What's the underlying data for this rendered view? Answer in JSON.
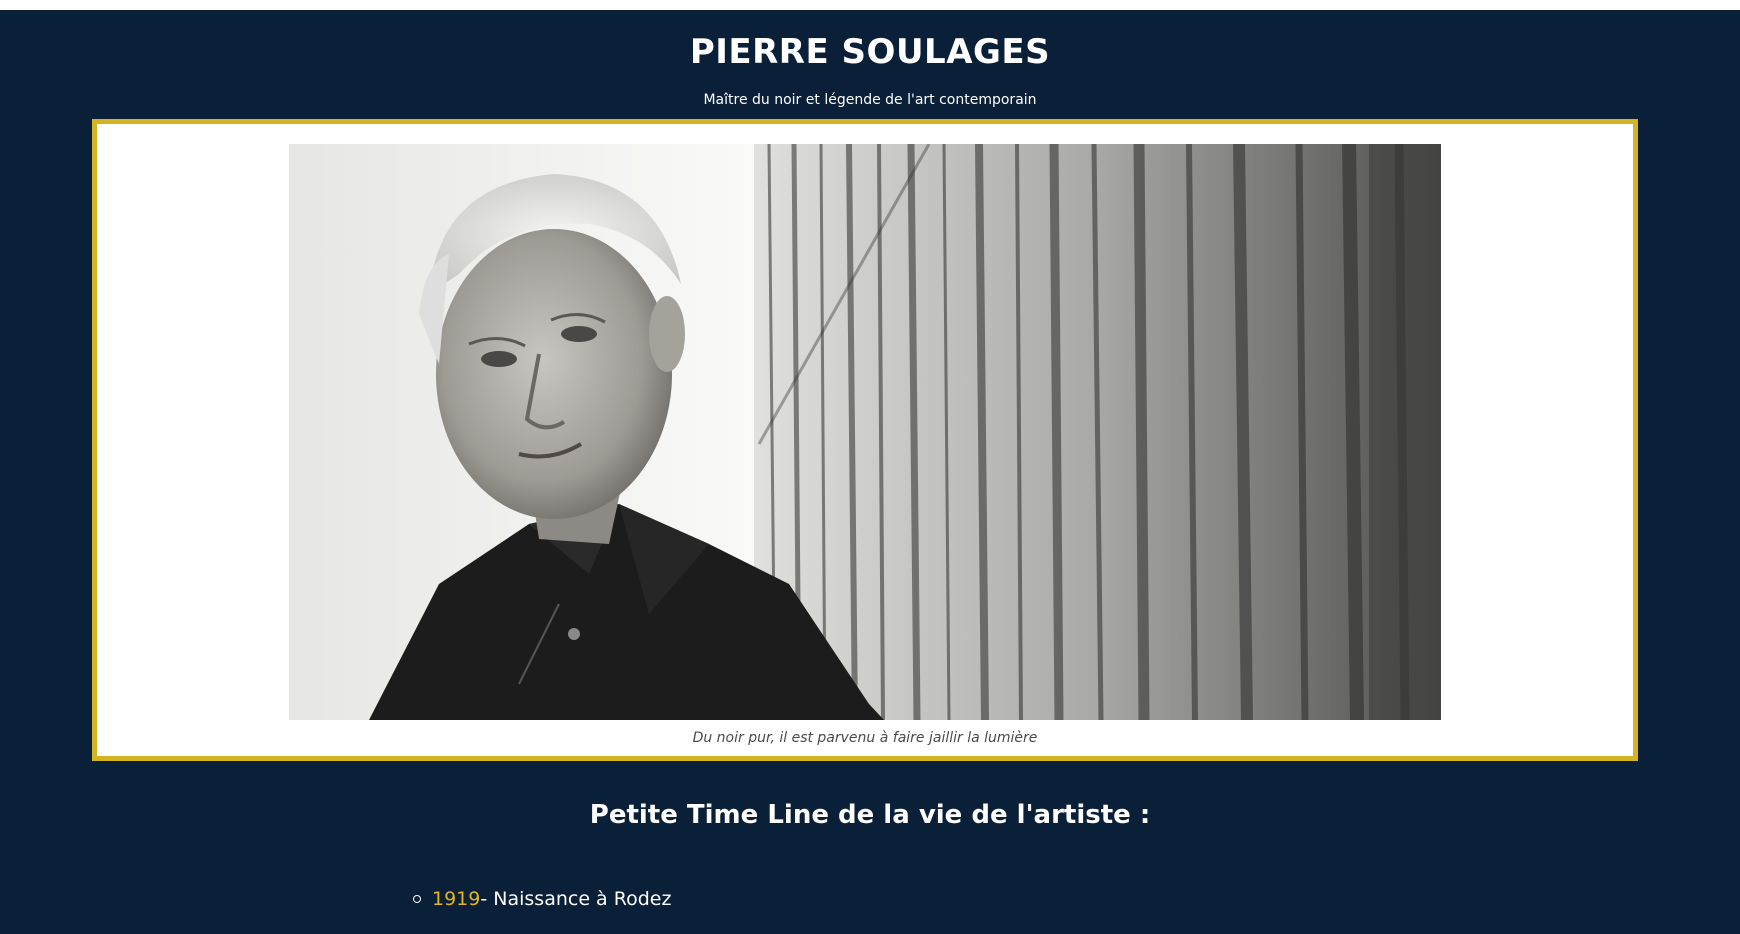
{
  "header": {
    "title": "PIERRE SOULAGES",
    "subtitle": "Maître du noir et légende de l'art contemporain"
  },
  "figure": {
    "image_alt": "portrait-of-pierre-soulages",
    "caption": "Du noir pur, il est parvenu à faire jaillir la lumière"
  },
  "timeline": {
    "heading": "Petite Time Line de la vie de l'artiste :",
    "items": [
      {
        "year": "1919",
        "text": " - Naissance à Rodez"
      }
    ]
  },
  "colors": {
    "background": "#0a1f38",
    "accent": "#d4b322",
    "year_color": "#e3b51d"
  }
}
